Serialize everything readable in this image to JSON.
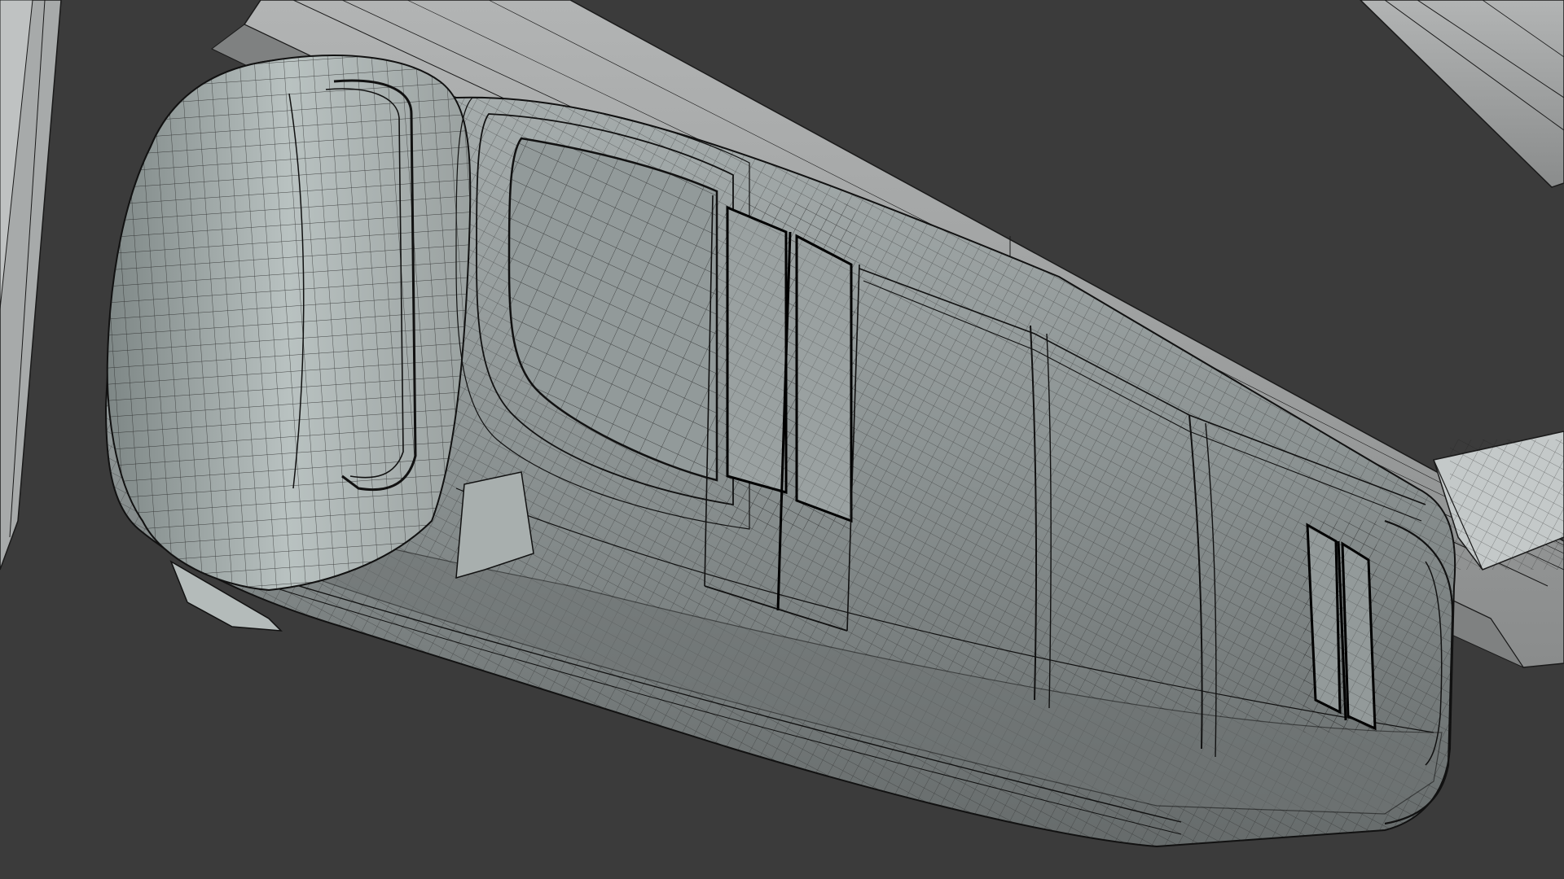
{
  "scene": {
    "description_visible_text": "",
    "colors": {
      "background": "#3b3b3b",
      "mesh_surface": "#8f9696",
      "mesh_surface_light": "#b7bdbc",
      "mesh_surface_dark": "#6f7474",
      "wire": "#1a1a1a",
      "wire_dense": "#000000"
    },
    "objects": [
      "overhead-rail-beam",
      "vehicle-body",
      "vehicle-front-nose",
      "vehicle-front-window",
      "door-front",
      "door-rear",
      "side-pillar",
      "left-support-column",
      "right-cross-beam",
      "right-bracket"
    ]
  }
}
